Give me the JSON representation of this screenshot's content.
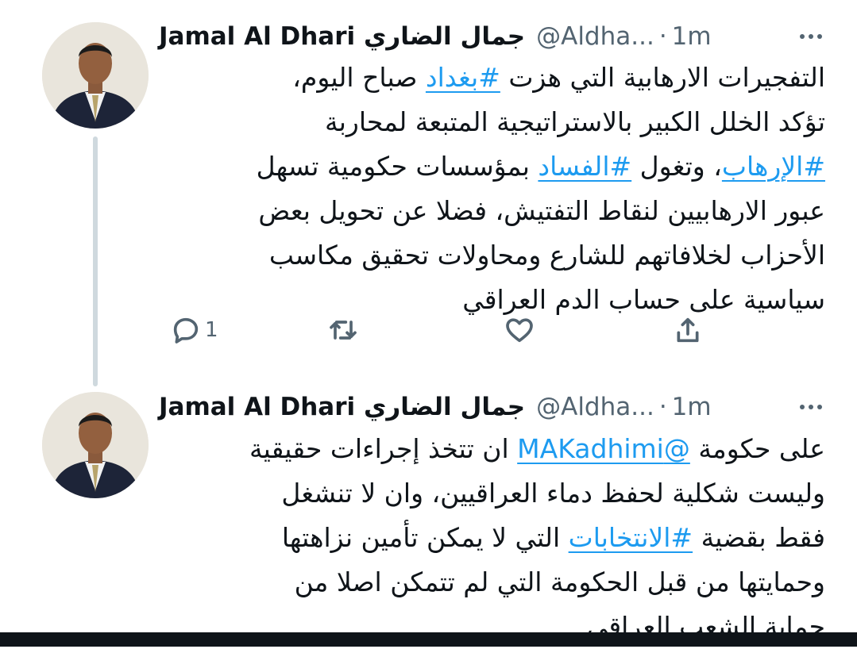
{
  "tweets": [
    {
      "author": {
        "name": "Jamal Al Dhari جمال الضاري",
        "handle": "@Aldha...",
        "time": "1m"
      },
      "separator": "·",
      "lines": [
        [
          {
            "t": "التفجيرات الارهابية التي هزت "
          },
          {
            "t": "#بغداد",
            "tag": true
          },
          {
            "t": " صباح اليوم،"
          }
        ],
        [
          {
            "t": "تؤكد الخلل الكبير بالاستراتيجية المتبعة لمحاربة"
          }
        ],
        [
          {
            "t": "#الإرهاب",
            "tag": true
          },
          {
            "t": "، وتغول "
          },
          {
            "t": "#الفساد",
            "tag": true
          },
          {
            "t": " بمؤسسات حكومية تسهل"
          }
        ],
        [
          {
            "t": "عبور الارهابيين لنقاط التفتيش، فضلا عن تحويل بعض"
          }
        ],
        [
          {
            "t": "الأحزاب لخلافاتهم للشارع ومحاولات تحقيق مكاسب"
          }
        ],
        [
          {
            "t": "سياسية على حساب الدم العراقي"
          }
        ]
      ],
      "actions": {
        "reply_count": "1",
        "retweet_icon": "retweet-icon",
        "like_icon": "heart-icon",
        "share_icon": "share-icon"
      }
    },
    {
      "author": {
        "name": "Jamal Al Dhari جمال الضاري",
        "handle": "@Aldha...",
        "time": "1m"
      },
      "separator": "·",
      "lines": [
        [
          {
            "t": "على حكومة "
          },
          {
            "t": "@MAKadhimi",
            "tag": true
          },
          {
            "t": " ان تتخذ إجراءات حقيقية"
          }
        ],
        [
          {
            "t": "وليست شكلية لحفظ دماء العراقيين، وان لا تنشغل"
          }
        ],
        [
          {
            "t": "فقط بقضية "
          },
          {
            "t": "#الانتخابات",
            "tag": true
          },
          {
            "t": " التي لا يمكن تأمين نزاهتها"
          }
        ],
        [
          {
            "t": "وحمايتها من قبل الحكومة التي لم تتمكن اصلا من"
          }
        ],
        [
          {
            "t": "حماية الشعب العراقي"
          }
        ]
      ]
    }
  ],
  "colors": {
    "link": "#1d9bf0",
    "secondary_text": "#536471",
    "thread_line": "#cfd9de",
    "primary_text": "#0f1419"
  }
}
